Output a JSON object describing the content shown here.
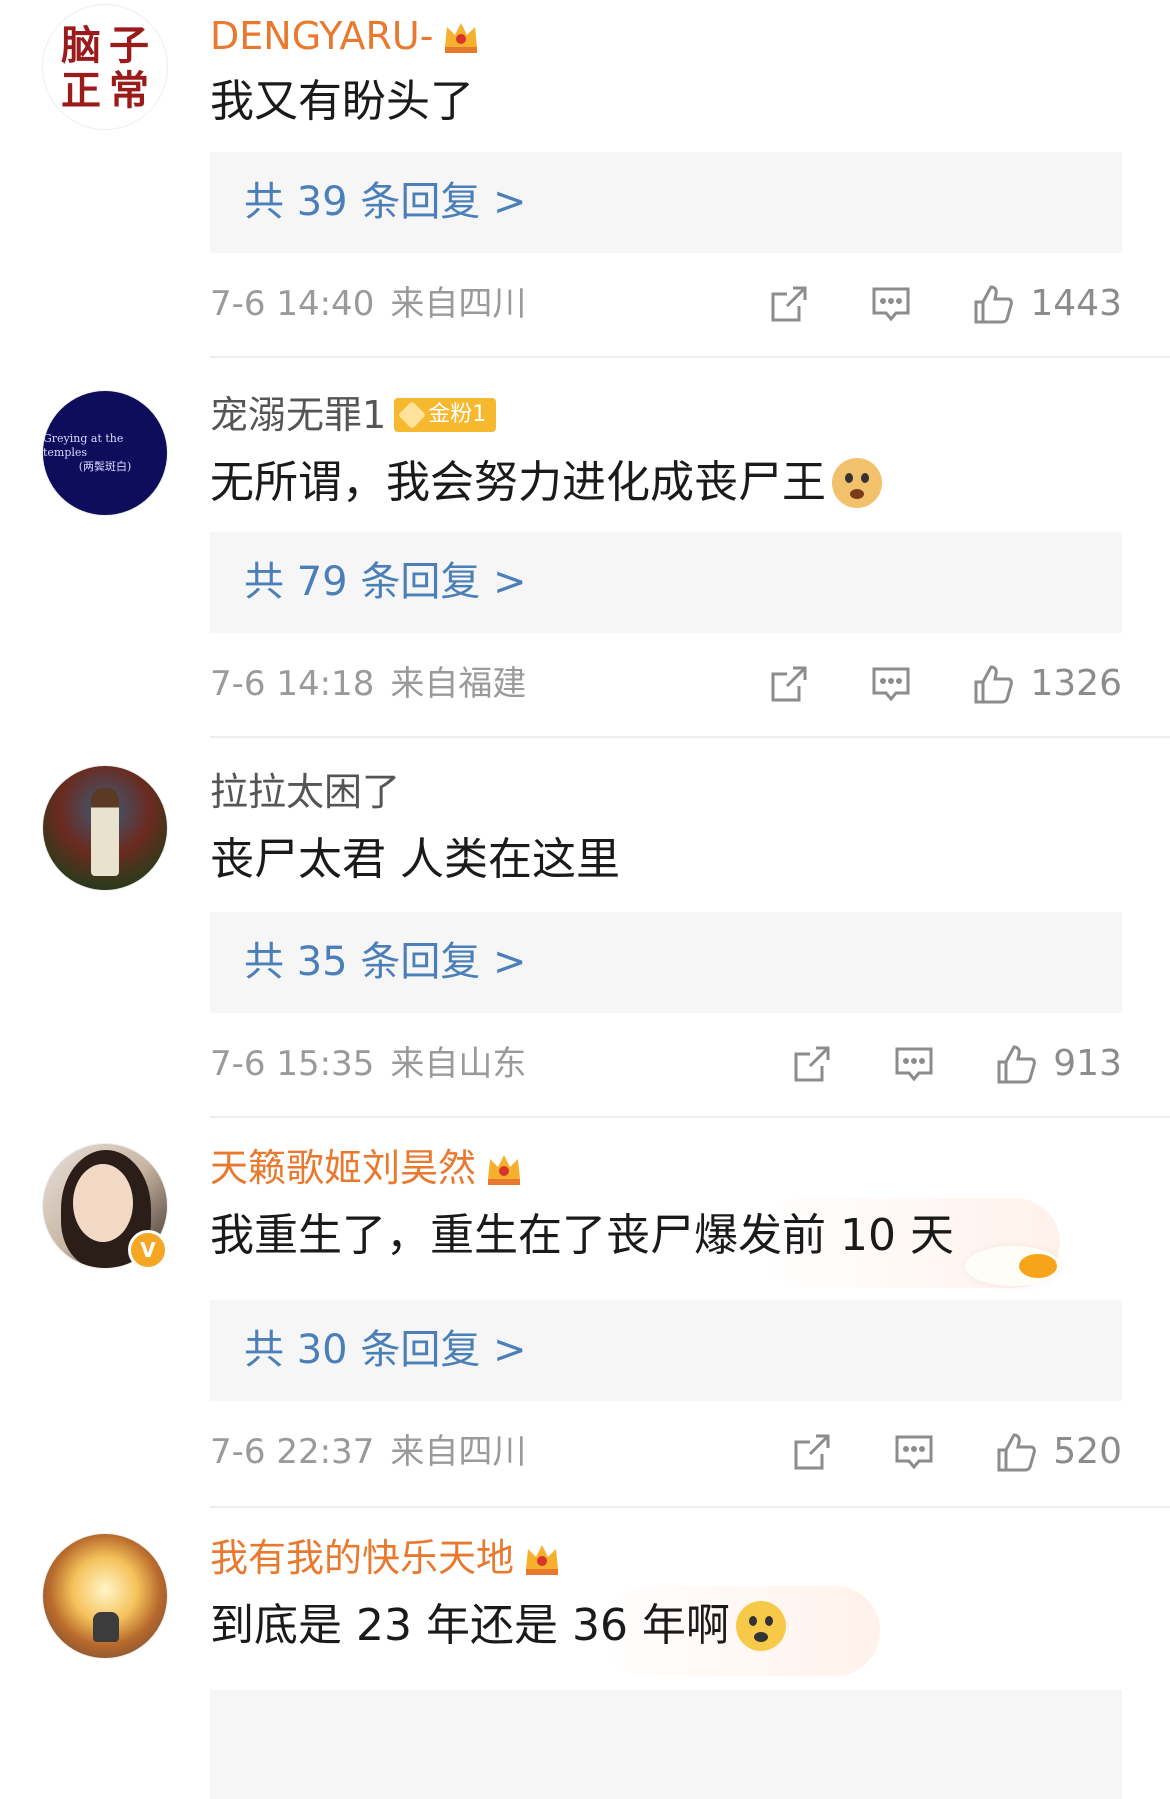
{
  "comments": [
    {
      "username": "DENGYARU-",
      "username_color": "#e8792f",
      "avatar_chars": [
        "脑",
        "子",
        "正",
        "常"
      ],
      "badge": "crown-icon",
      "content": "我又有盼头了",
      "replies_label": "共 39 条回复 >",
      "time": "7-6 14:40",
      "location": "来自四川",
      "likes": "1443"
    },
    {
      "username": "宠溺无罪1",
      "username_color": "#555555",
      "avatar_text_line1": "Greying at the temples",
      "avatar_text_line2": "(两鬓斑白)",
      "fan_badge": "金粉1",
      "content": "无所谓，我会努力进化成丧尸王",
      "emoji": "doge-emoji-icon",
      "replies_label": "共 79 条回复 >",
      "time": "7-6 14:18",
      "location": "来自福建",
      "likes": "1326"
    },
    {
      "username": "拉拉太困了",
      "username_color": "#555555",
      "content": "丧尸太君 人类在这里",
      "replies_label": "共 35 条回复 >",
      "time": "7-6 15:35",
      "location": "来自山东",
      "likes": "913"
    },
    {
      "username": "天籁歌姬刘昊然",
      "username_color": "#e8792f",
      "badge": "crown-icon",
      "verified_badge": "V",
      "content": "我重生了，重生在了丧尸爆发前 10 天",
      "replies_label": "共 30 条回复 >",
      "time": "7-6 22:37",
      "location": "来自四川",
      "likes": "520"
    },
    {
      "username": "我有我的快乐天地",
      "username_color": "#e8792f",
      "badge": "crown-icon",
      "content": "到底是 23 年还是 36 年啊",
      "emoji": "shocked-emoji-icon"
    }
  ],
  "colors": {
    "link_blue": "#4a7fb8",
    "meta_gray": "#9a9a9a",
    "orange_vip": "#e8792f"
  },
  "icons": {
    "share": "share-icon",
    "reply": "comment-icon",
    "like": "thumbs-up-icon"
  }
}
